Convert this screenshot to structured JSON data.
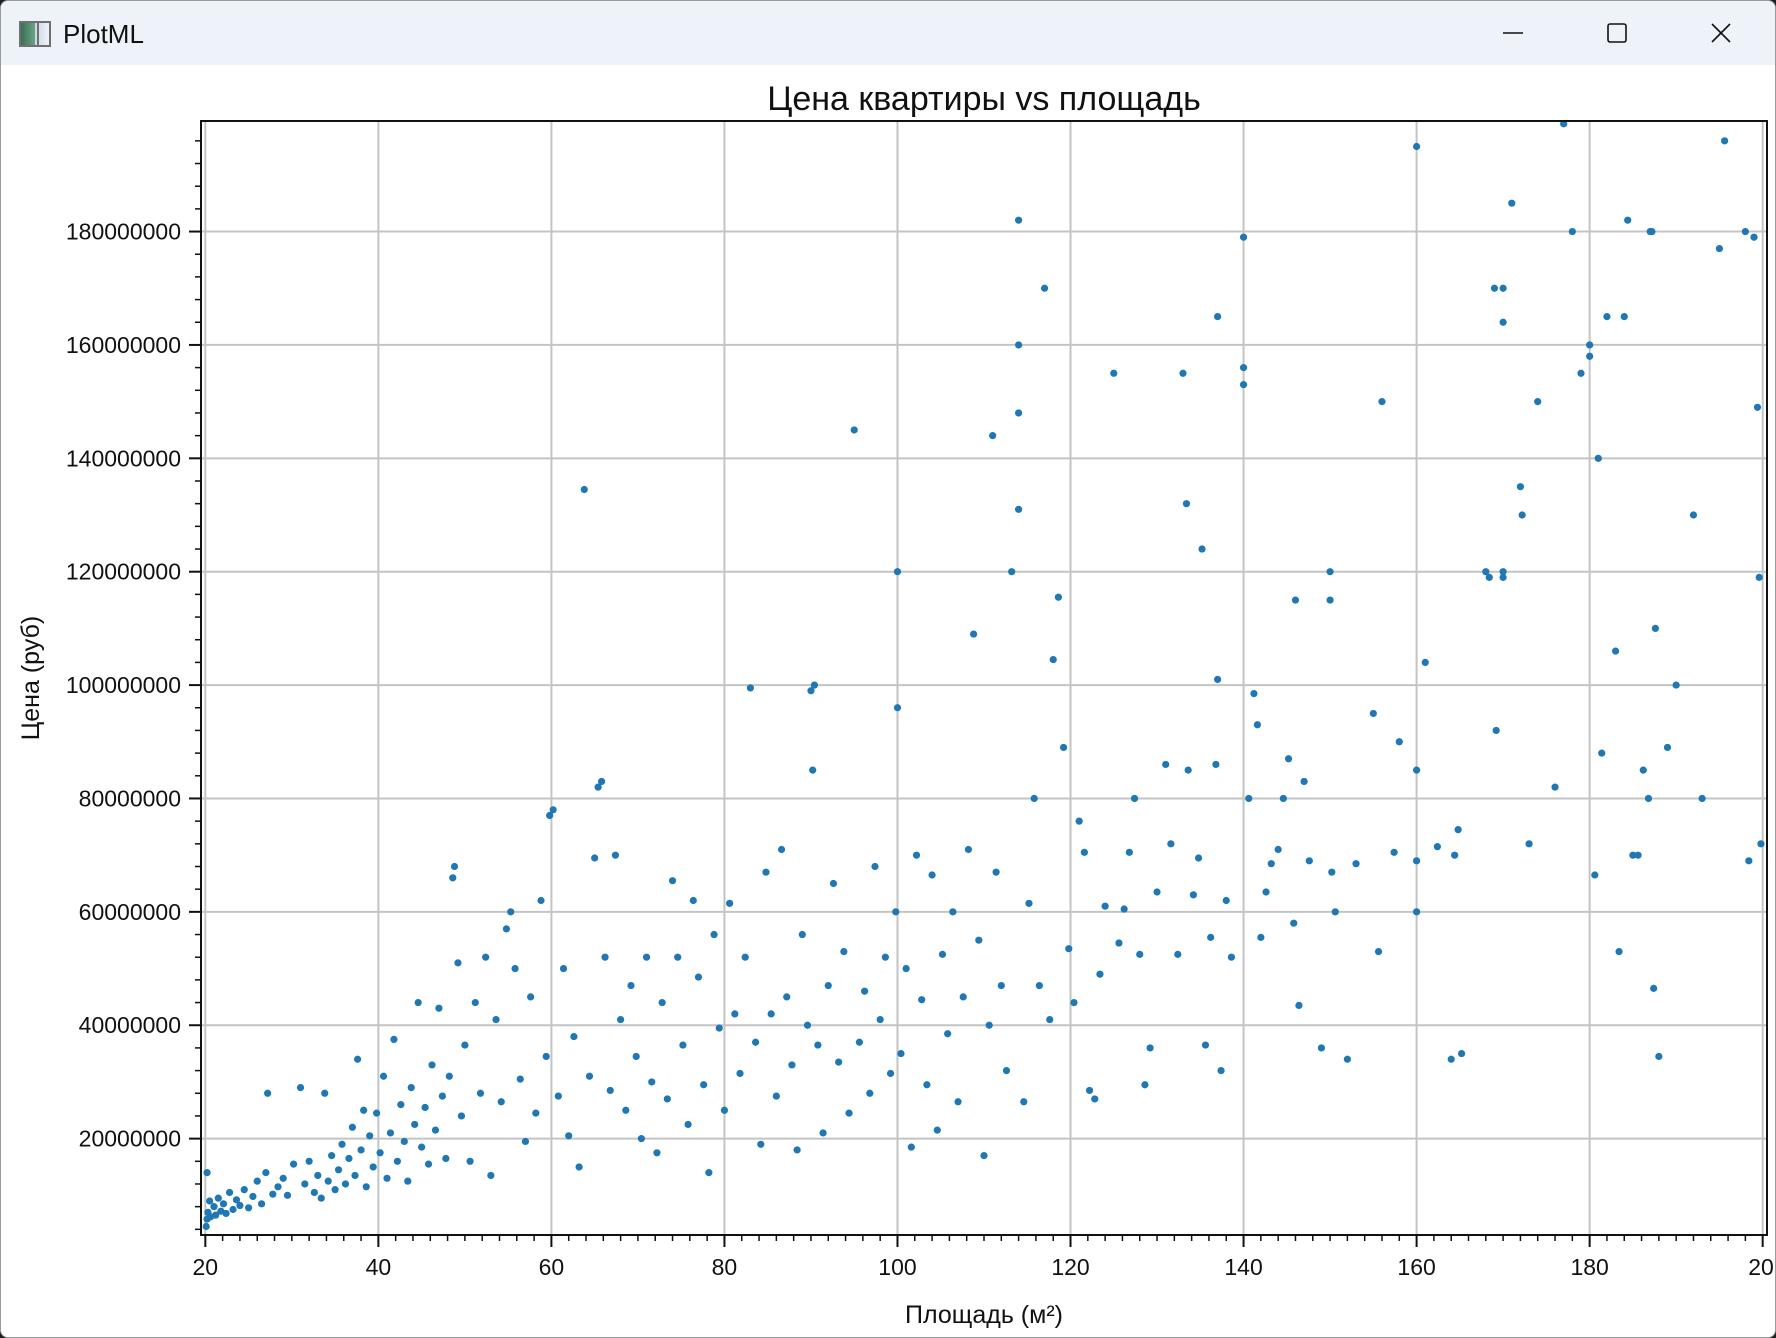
{
  "window": {
    "title": "PlotML"
  },
  "controls": {
    "minimize": "minimize",
    "maximize": "maximize",
    "close": "close"
  },
  "chart_data": {
    "type": "scatter",
    "title": "Цена квартиры vs площадь",
    "xlabel": "Площадь (м²)",
    "ylabel": "Цена (руб)",
    "xlim": [
      19.5,
      200.5
    ],
    "ylim": [
      3000000,
      199500000
    ],
    "x_ticks": [
      20,
      40,
      60,
      80,
      100,
      120,
      140,
      160,
      180,
      200
    ],
    "x_tick_labels": [
      "20",
      "40",
      "60",
      "80",
      "100",
      "120",
      "140",
      "160",
      "180",
      "20"
    ],
    "y_ticks": [
      20000000,
      40000000,
      60000000,
      80000000,
      100000000,
      120000000,
      140000000,
      160000000,
      180000000
    ],
    "y_tick_labels": [
      "20000000",
      "40000000",
      "60000000",
      "80000000",
      "100000000",
      "120000000",
      "140000000",
      "160000000",
      "180000000"
    ],
    "grid": true,
    "marker_color": "#1f77b4",
    "points": [
      [
        20.1,
        4500000
      ],
      [
        20.2,
        5800000
      ],
      [
        20.3,
        7000000
      ],
      [
        20.5,
        9000000
      ],
      [
        20.2,
        14000000
      ],
      [
        20.6,
        6200000
      ],
      [
        21.0,
        8000000
      ],
      [
        21.2,
        6500000
      ],
      [
        21.5,
        9500000
      ],
      [
        21.8,
        7200000
      ],
      [
        22.1,
        8500000
      ],
      [
        22.4,
        6800000
      ],
      [
        22.8,
        10500000
      ],
      [
        23.2,
        7500000
      ],
      [
        23.6,
        9200000
      ],
      [
        24.0,
        8200000
      ],
      [
        24.5,
        11000000
      ],
      [
        25.0,
        7800000
      ],
      [
        25.5,
        9800000
      ],
      [
        26.0,
        12500000
      ],
      [
        26.5,
        8500000
      ],
      [
        27.0,
        14000000
      ],
      [
        27.2,
        28000000
      ],
      [
        27.8,
        10200000
      ],
      [
        28.4,
        11500000
      ],
      [
        29.0,
        13000000
      ],
      [
        29.5,
        10000000
      ],
      [
        30.2,
        15500000
      ],
      [
        31.0,
        29000000
      ],
      [
        31.5,
        12000000
      ],
      [
        32.0,
        16000000
      ],
      [
        32.6,
        10500000
      ],
      [
        33.0,
        13500000
      ],
      [
        33.4,
        9500000
      ],
      [
        33.8,
        28000000
      ],
      [
        34.2,
        12500000
      ],
      [
        34.6,
        17000000
      ],
      [
        35.0,
        11000000
      ],
      [
        35.4,
        14500000
      ],
      [
        35.8,
        19000000
      ],
      [
        36.2,
        12000000
      ],
      [
        36.6,
        16500000
      ],
      [
        37.0,
        22000000
      ],
      [
        37.3,
        13500000
      ],
      [
        37.6,
        34000000
      ],
      [
        38.0,
        18000000
      ],
      [
        38.3,
        25000000
      ],
      [
        38.6,
        11500000
      ],
      [
        39.0,
        20500000
      ],
      [
        39.4,
        15000000
      ],
      [
        39.8,
        24500000
      ],
      [
        40.2,
        17500000
      ],
      [
        40.6,
        31000000
      ],
      [
        41.0,
        13000000
      ],
      [
        41.4,
        21000000
      ],
      [
        41.8,
        37500000
      ],
      [
        42.2,
        16000000
      ],
      [
        42.6,
        26000000
      ],
      [
        43.0,
        19500000
      ],
      [
        43.4,
        12500000
      ],
      [
        43.8,
        29000000
      ],
      [
        44.2,
        22500000
      ],
      [
        44.6,
        44000000
      ],
      [
        45.0,
        18500000
      ],
      [
        45.4,
        25500000
      ],
      [
        45.8,
        15500000
      ],
      [
        46.2,
        33000000
      ],
      [
        46.6,
        21500000
      ],
      [
        47.0,
        43000000
      ],
      [
        47.4,
        27500000
      ],
      [
        47.8,
        16500000
      ],
      [
        48.2,
        31000000
      ],
      [
        48.6,
        66000000
      ],
      [
        48.8,
        68000000
      ],
      [
        49.2,
        51000000
      ],
      [
        49.6,
        24000000
      ],
      [
        50.0,
        36500000
      ],
      [
        50.6,
        16000000
      ],
      [
        51.2,
        44000000
      ],
      [
        51.8,
        28000000
      ],
      [
        52.4,
        52000000
      ],
      [
        53.0,
        13500000
      ],
      [
        53.6,
        41000000
      ],
      [
        54.2,
        26500000
      ],
      [
        54.8,
        57000000
      ],
      [
        55.3,
        60000000
      ],
      [
        55.8,
        50000000
      ],
      [
        56.4,
        30500000
      ],
      [
        57.0,
        19500000
      ],
      [
        57.6,
        45000000
      ],
      [
        58.2,
        24500000
      ],
      [
        58.8,
        62000000
      ],
      [
        59.4,
        34500000
      ],
      [
        59.8,
        77000000
      ],
      [
        60.2,
        78000000
      ],
      [
        60.8,
        27500000
      ],
      [
        61.4,
        50000000
      ],
      [
        62.0,
        20500000
      ],
      [
        62.6,
        38000000
      ],
      [
        63.2,
        15000000
      ],
      [
        63.8,
        134500000
      ],
      [
        64.4,
        31000000
      ],
      [
        65.0,
        69500000
      ],
      [
        65.4,
        82000000
      ],
      [
        65.8,
        83000000
      ],
      [
        66.2,
        52000000
      ],
      [
        66.8,
        28500000
      ],
      [
        67.4,
        70000000
      ],
      [
        68.0,
        41000000
      ],
      [
        68.6,
        25000000
      ],
      [
        69.2,
        47000000
      ],
      [
        69.8,
        34500000
      ],
      [
        70.4,
        20000000
      ],
      [
        71.0,
        52000000
      ],
      [
        71.6,
        30000000
      ],
      [
        72.2,
        17500000
      ],
      [
        72.8,
        44000000
      ],
      [
        73.4,
        27000000
      ],
      [
        74.0,
        65500000
      ],
      [
        74.6,
        52000000
      ],
      [
        75.2,
        36500000
      ],
      [
        75.8,
        22500000
      ],
      [
        76.4,
        62000000
      ],
      [
        77.0,
        48500000
      ],
      [
        77.6,
        29500000
      ],
      [
        78.2,
        14000000
      ],
      [
        78.8,
        56000000
      ],
      [
        79.4,
        39500000
      ],
      [
        80.0,
        25000000
      ],
      [
        80.6,
        61500000
      ],
      [
        81.2,
        42000000
      ],
      [
        81.8,
        31500000
      ],
      [
        82.4,
        52000000
      ],
      [
        83.0,
        99500000
      ],
      [
        83.6,
        37000000
      ],
      [
        84.2,
        19000000
      ],
      [
        84.8,
        67000000
      ],
      [
        85.4,
        42000000
      ],
      [
        86.0,
        27500000
      ],
      [
        86.6,
        71000000
      ],
      [
        87.2,
        45000000
      ],
      [
        87.8,
        33000000
      ],
      [
        88.4,
        18000000
      ],
      [
        89.0,
        56000000
      ],
      [
        89.6,
        40000000
      ],
      [
        90.0,
        99000000
      ],
      [
        90.2,
        85000000
      ],
      [
        90.4,
        100000000
      ],
      [
        90.8,
        36500000
      ],
      [
        91.4,
        21000000
      ],
      [
        92.0,
        47000000
      ],
      [
        92.6,
        65000000
      ],
      [
        93.2,
        33500000
      ],
      [
        93.8,
        53000000
      ],
      [
        94.4,
        24500000
      ],
      [
        95.0,
        145000000
      ],
      [
        95.6,
        37000000
      ],
      [
        96.2,
        46000000
      ],
      [
        96.8,
        28000000
      ],
      [
        97.4,
        68000000
      ],
      [
        98.0,
        41000000
      ],
      [
        98.6,
        52000000
      ],
      [
        99.2,
        31500000
      ],
      [
        99.8,
        60000000
      ],
      [
        100.0,
        120000000
      ],
      [
        100.0,
        96000000
      ],
      [
        100.4,
        35000000
      ],
      [
        101.0,
        50000000
      ],
      [
        101.6,
        18500000
      ],
      [
        102.2,
        70000000
      ],
      [
        102.8,
        44500000
      ],
      [
        103.4,
        29500000
      ],
      [
        104.0,
        66500000
      ],
      [
        104.6,
        21500000
      ],
      [
        105.2,
        52500000
      ],
      [
        105.8,
        38500000
      ],
      [
        106.4,
        60000000
      ],
      [
        107.0,
        26500000
      ],
      [
        107.6,
        45000000
      ],
      [
        108.2,
        71000000
      ],
      [
        108.8,
        109000000
      ],
      [
        109.4,
        55000000
      ],
      [
        110.0,
        17000000
      ],
      [
        110.6,
        40000000
      ],
      [
        111.0,
        144000000
      ],
      [
        111.4,
        67000000
      ],
      [
        112.0,
        47000000
      ],
      [
        112.6,
        32000000
      ],
      [
        113.2,
        120000000
      ],
      [
        114.0,
        182000000
      ],
      [
        114.0,
        160000000
      ],
      [
        114.0,
        148000000
      ],
      [
        114.0,
        131000000
      ],
      [
        114.6,
        26500000
      ],
      [
        115.2,
        61500000
      ],
      [
        115.8,
        80000000
      ],
      [
        116.4,
        47000000
      ],
      [
        117.0,
        170000000
      ],
      [
        117.6,
        41000000
      ],
      [
        118.0,
        104500000
      ],
      [
        118.6,
        115500000
      ],
      [
        119.2,
        89000000
      ],
      [
        119.8,
        53500000
      ],
      [
        120.4,
        44000000
      ],
      [
        121.0,
        76000000
      ],
      [
        121.6,
        70500000
      ],
      [
        122.2,
        28500000
      ],
      [
        122.8,
        27000000
      ],
      [
        123.4,
        49000000
      ],
      [
        124.0,
        61000000
      ],
      [
        125.0,
        155000000
      ],
      [
        125.6,
        54500000
      ],
      [
        126.2,
        60500000
      ],
      [
        126.8,
        70500000
      ],
      [
        127.4,
        80000000
      ],
      [
        128.0,
        52500000
      ],
      [
        128.6,
        29500000
      ],
      [
        129.2,
        36000000
      ],
      [
        130.0,
        63500000
      ],
      [
        131.0,
        86000000
      ],
      [
        131.6,
        72000000
      ],
      [
        132.4,
        52500000
      ],
      [
        133.0,
        155000000
      ],
      [
        133.4,
        132000000
      ],
      [
        133.6,
        85000000
      ],
      [
        134.2,
        63000000
      ],
      [
        134.8,
        69500000
      ],
      [
        135.2,
        124000000
      ],
      [
        135.6,
        36500000
      ],
      [
        136.2,
        55500000
      ],
      [
        136.8,
        86000000
      ],
      [
        137.0,
        165000000
      ],
      [
        137.0,
        101000000
      ],
      [
        137.4,
        32000000
      ],
      [
        138.0,
        62000000
      ],
      [
        138.6,
        52000000
      ],
      [
        140.0,
        179000000
      ],
      [
        140.0,
        156000000
      ],
      [
        140.0,
        153000000
      ],
      [
        140.6,
        80000000
      ],
      [
        141.2,
        98500000
      ],
      [
        141.6,
        93000000
      ],
      [
        142.0,
        55500000
      ],
      [
        142.6,
        63500000
      ],
      [
        143.2,
        68500000
      ],
      [
        144.0,
        71000000
      ],
      [
        144.6,
        80000000
      ],
      [
        145.2,
        87000000
      ],
      [
        145.8,
        58000000
      ],
      [
        146.0,
        115000000
      ],
      [
        146.4,
        43500000
      ],
      [
        147.0,
        83000000
      ],
      [
        147.6,
        69000000
      ],
      [
        149.0,
        36000000
      ],
      [
        150.0,
        120000000
      ],
      [
        150.0,
        115000000
      ],
      [
        150.2,
        67000000
      ],
      [
        150.6,
        60000000
      ],
      [
        152.0,
        34000000
      ],
      [
        153.0,
        68500000
      ],
      [
        155.0,
        95000000
      ],
      [
        155.6,
        53000000
      ],
      [
        156.0,
        150000000
      ],
      [
        157.4,
        70500000
      ],
      [
        158.0,
        90000000
      ],
      [
        160.0,
        195000000
      ],
      [
        160.0,
        85000000
      ],
      [
        160.0,
        69000000
      ],
      [
        160.0,
        60000000
      ],
      [
        161.0,
        104000000
      ],
      [
        162.4,
        71500000
      ],
      [
        164.0,
        34000000
      ],
      [
        164.4,
        70000000
      ],
      [
        164.8,
        74500000
      ],
      [
        165.2,
        35000000
      ],
      [
        168.0,
        120000000
      ],
      [
        168.4,
        119000000
      ],
      [
        169.0,
        170000000
      ],
      [
        169.2,
        92000000
      ],
      [
        170.0,
        170000000
      ],
      [
        170.0,
        164000000
      ],
      [
        170.0,
        120000000
      ],
      [
        170.0,
        119000000
      ],
      [
        171.0,
        185000000
      ],
      [
        172.0,
        135000000
      ],
      [
        172.2,
        130000000
      ],
      [
        173.0,
        72000000
      ],
      [
        174.0,
        150000000
      ],
      [
        176.0,
        82000000
      ],
      [
        177.0,
        199000000
      ],
      [
        178.0,
        180000000
      ],
      [
        179.0,
        155000000
      ],
      [
        180.0,
        160000000
      ],
      [
        180.0,
        158000000
      ],
      [
        180.6,
        66500000
      ],
      [
        181.0,
        140000000
      ],
      [
        181.4,
        88000000
      ],
      [
        182.0,
        165000000
      ],
      [
        183.0,
        106000000
      ],
      [
        183.4,
        53000000
      ],
      [
        184.0,
        165000000
      ],
      [
        184.4,
        182000000
      ],
      [
        185.0,
        70000000
      ],
      [
        185.6,
        70000000
      ],
      [
        186.2,
        85000000
      ],
      [
        186.8,
        80000000
      ],
      [
        187.0,
        180000000
      ],
      [
        187.2,
        180000000
      ],
      [
        187.6,
        110000000
      ],
      [
        187.4,
        46500000
      ],
      [
        188.0,
        34500000
      ],
      [
        189.0,
        89000000
      ],
      [
        190.0,
        100000000
      ],
      [
        192.0,
        130000000
      ],
      [
        193.0,
        80000000
      ],
      [
        195.0,
        177000000
      ],
      [
        195.6,
        196000000
      ],
      [
        198.0,
        180000000
      ],
      [
        198.4,
        69000000
      ],
      [
        199.0,
        179000000
      ],
      [
        199.4,
        149000000
      ],
      [
        199.6,
        119000000
      ],
      [
        199.8,
        72000000
      ]
    ]
  }
}
